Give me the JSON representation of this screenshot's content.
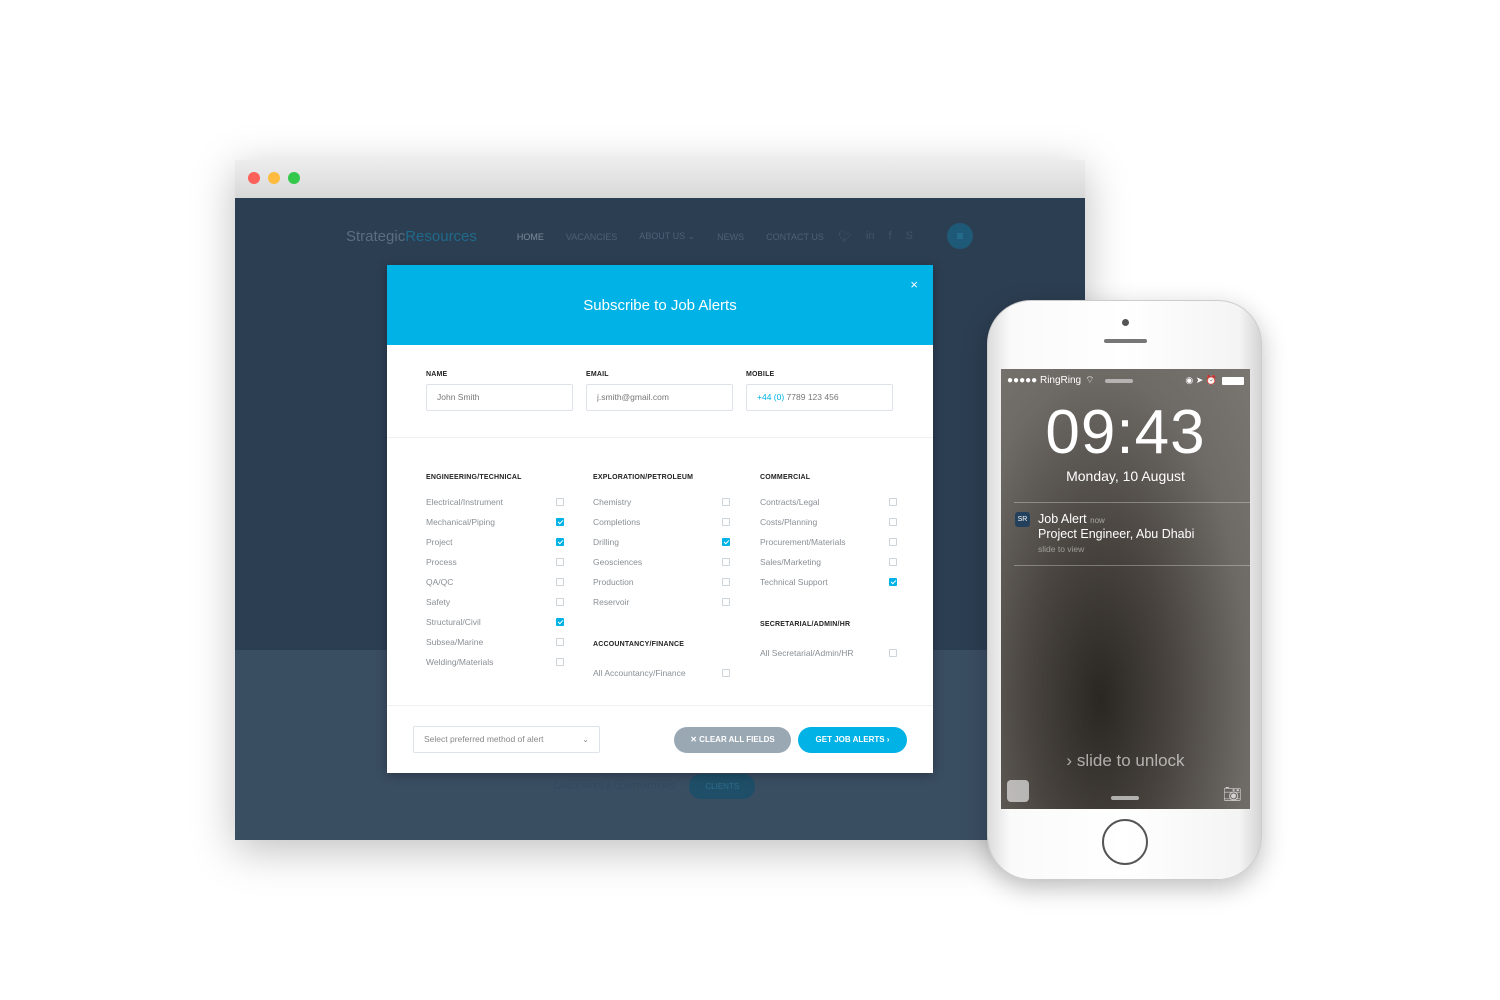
{
  "browser": {
    "traffic_lights": [
      "#fc605b",
      "#fdbc40",
      "#34c84a"
    ]
  },
  "site": {
    "logo": {
      "part1": "Strategic",
      "part2": "Resources"
    },
    "nav": [
      "HOME",
      "VACANCIES",
      "ABOUT US ⌄",
      "NEWS",
      "CONTACT US"
    ],
    "social_icons": [
      "twitter-icon",
      "linkedin-icon",
      "facebook-icon",
      "skype-icon"
    ],
    "bottom_tabs": [
      "CANDIDATES & CONTRACTORS",
      "CLIENTS"
    ]
  },
  "modal": {
    "title": "Subscribe to Job Alerts",
    "close": "×",
    "accent": "#00b2e5",
    "fields": [
      {
        "label": "NAME",
        "value": "John Smith"
      },
      {
        "label": "EMAIL",
        "value": "j.smith@gmail.com"
      },
      {
        "label": "MOBILE",
        "code": "+44 (0)",
        "value": "7789 123 456"
      }
    ],
    "categories": {
      "eng": {
        "title": "ENGINEERING/TECHNICAL",
        "items": [
          {
            "label": "Electrical/Instrument",
            "checked": false
          },
          {
            "label": "Mechanical/Piping",
            "checked": true
          },
          {
            "label": "Project",
            "checked": true
          },
          {
            "label": "Process",
            "checked": false
          },
          {
            "label": "QA/QC",
            "checked": false
          },
          {
            "label": "Safety",
            "checked": false
          },
          {
            "label": "Structural/Civil",
            "checked": true
          },
          {
            "label": "Subsea/Marine",
            "checked": false
          },
          {
            "label": "Welding/Materials",
            "checked": false
          }
        ]
      },
      "exp": {
        "title": "EXPLORATION/PETROLEUM",
        "items": [
          {
            "label": "Chemistry",
            "checked": false
          },
          {
            "label": "Completions",
            "checked": false
          },
          {
            "label": "Drilling",
            "checked": true
          },
          {
            "label": "Geosciences",
            "checked": false
          },
          {
            "label": "Production",
            "checked": false
          },
          {
            "label": "Reservoir",
            "checked": false
          }
        ]
      },
      "acc": {
        "title": "ACCOUNTANCY/FINANCE",
        "items": [
          {
            "label": "All Accountancy/Finance",
            "checked": false
          }
        ]
      },
      "com": {
        "title": "COMMERCIAL",
        "items": [
          {
            "label": "Contracts/Legal",
            "checked": false
          },
          {
            "label": "Costs/Planning",
            "checked": false
          },
          {
            "label": "Procurement/Materials",
            "checked": false
          },
          {
            "label": "Sales/Marketing",
            "checked": false
          },
          {
            "label": "Technical Support",
            "checked": true
          }
        ]
      },
      "sec": {
        "title": "SECRETARIAL/ADMIN/HR",
        "items": [
          {
            "label": "All Secretarial/Admin/HR",
            "checked": false
          }
        ]
      }
    },
    "alert_method": {
      "placeholder": "Select preferred method of alert"
    },
    "clear_label": "✕  CLEAR ALL FIELDS",
    "submit_label": "GET JOB ALERTS  ›"
  },
  "phone": {
    "carrier": "●●●●● RingRing",
    "time": "09:43",
    "date": "Monday, 10 August",
    "notification": {
      "app_icon": "SR",
      "title": "Job Alert",
      "when": "now",
      "body": "Project Engineer, Abu Dhabi",
      "hint": "slide to view"
    },
    "unlock": "slide to unlock"
  }
}
